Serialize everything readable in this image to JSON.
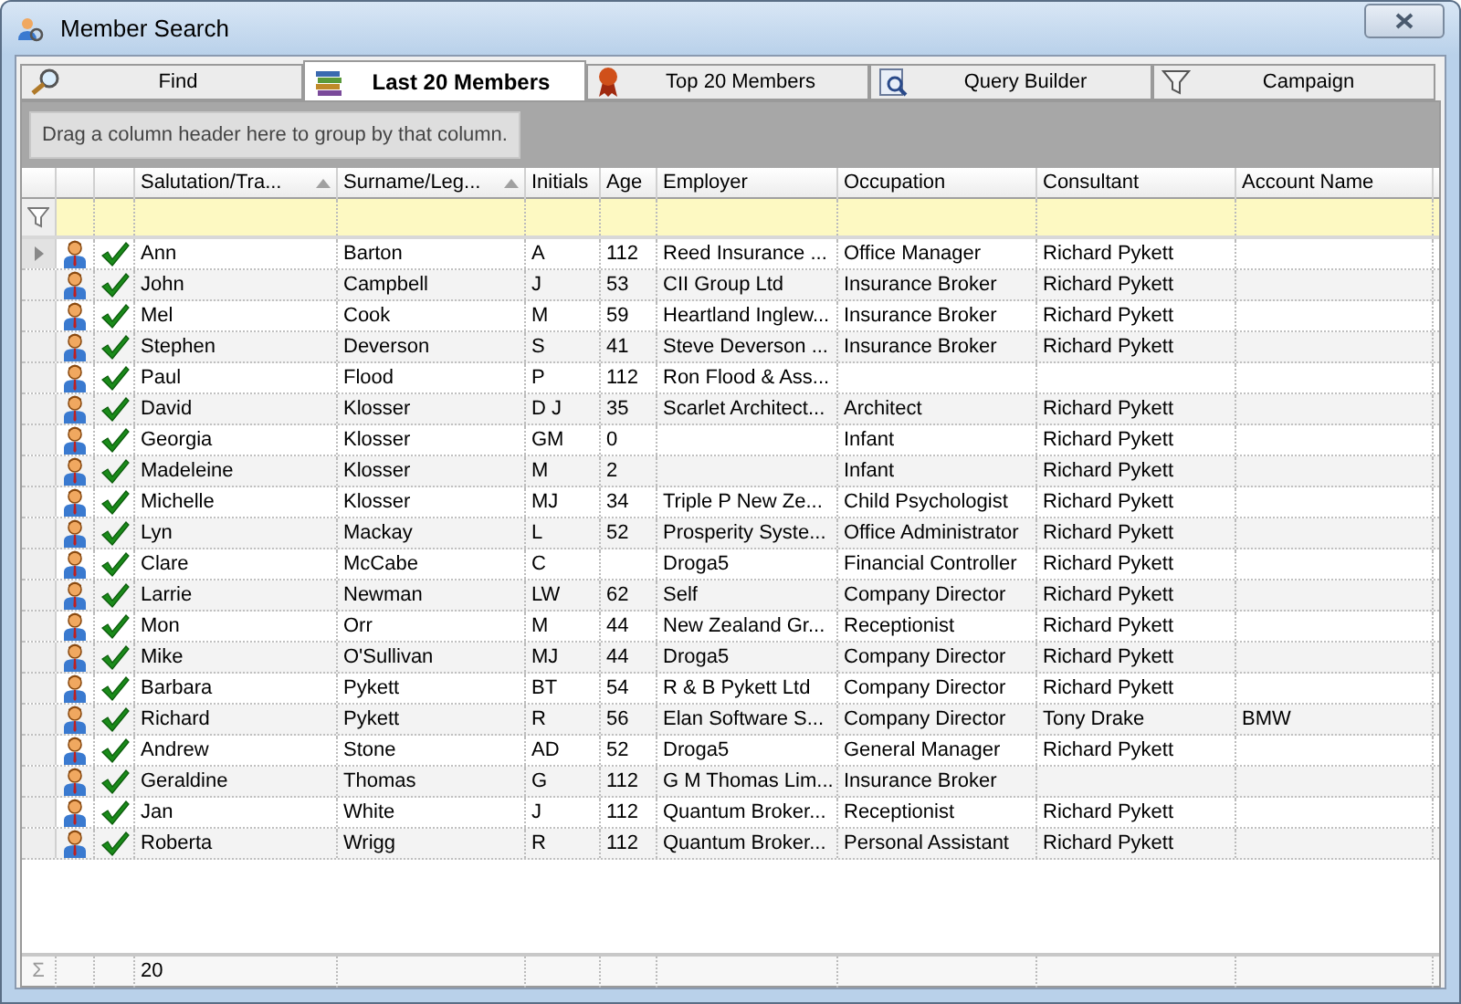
{
  "window": {
    "title": "Member Search"
  },
  "tabs": [
    {
      "label": "Find",
      "kind": "search",
      "selected": false
    },
    {
      "label": "Last 20 Members",
      "kind": "books",
      "selected": true
    },
    {
      "label": "Top 20 Members",
      "kind": "ribbon",
      "selected": false
    },
    {
      "label": "Query Builder",
      "kind": "query",
      "selected": false
    },
    {
      "label": "Campaign",
      "kind": "funnel",
      "selected": false
    }
  ],
  "group_panel": {
    "hint": "Drag a column header here to group by that column."
  },
  "table": {
    "columns": [
      {
        "label": "Salutation/Tra...",
        "sorted": true
      },
      {
        "label": "Surname/Leg...",
        "sorted": true
      },
      {
        "label": "Initials",
        "sorted": false
      },
      {
        "label": "Age",
        "sorted": false
      },
      {
        "label": "Employer",
        "sorted": false
      },
      {
        "label": "Occupation",
        "sorted": false
      },
      {
        "label": "Consultant",
        "sorted": false
      },
      {
        "label": "Account Name",
        "sorted": false
      }
    ],
    "rows": [
      {
        "selected": true,
        "verified": true,
        "cells": [
          "Ann",
          "Barton",
          "A",
          "112",
          "Reed Insurance ...",
          "Office Manager",
          "Richard Pykett",
          ""
        ]
      },
      {
        "selected": false,
        "verified": true,
        "cells": [
          "John",
          "Campbell",
          "J",
          "53",
          "CII Group Ltd",
          "Insurance Broker",
          "Richard Pykett",
          ""
        ]
      },
      {
        "selected": false,
        "verified": true,
        "cells": [
          "Mel",
          "Cook",
          "M",
          "59",
          "Heartland Inglew...",
          "Insurance Broker",
          "Richard Pykett",
          ""
        ]
      },
      {
        "selected": false,
        "verified": true,
        "cells": [
          "Stephen",
          "Deverson",
          "S",
          "41",
          "Steve Deverson ...",
          "Insurance Broker",
          "Richard Pykett",
          ""
        ]
      },
      {
        "selected": false,
        "verified": true,
        "cells": [
          "Paul",
          "Flood",
          "P",
          "112",
          "Ron Flood & Ass...",
          "",
          "",
          ""
        ]
      },
      {
        "selected": false,
        "verified": true,
        "cells": [
          "David",
          "Klosser",
          "D J",
          "35",
          "Scarlet Architect...",
          "Architect",
          "Richard Pykett",
          ""
        ]
      },
      {
        "selected": false,
        "verified": true,
        "cells": [
          "Georgia",
          "Klosser",
          "GM",
          "0",
          "",
          "Infant",
          "Richard Pykett",
          ""
        ]
      },
      {
        "selected": false,
        "verified": true,
        "cells": [
          "Madeleine",
          "Klosser",
          "M",
          "2",
          "",
          "Infant",
          "Richard Pykett",
          ""
        ]
      },
      {
        "selected": false,
        "verified": true,
        "cells": [
          "Michelle",
          "Klosser",
          "MJ",
          "34",
          "Triple P New Ze...",
          "Child Psychologist",
          "Richard Pykett",
          ""
        ]
      },
      {
        "selected": false,
        "verified": true,
        "cells": [
          "Lyn",
          "Mackay",
          "L",
          "52",
          "Prosperity Syste...",
          "Office Administrator",
          "Richard Pykett",
          ""
        ]
      },
      {
        "selected": false,
        "verified": true,
        "cells": [
          "Clare",
          "McCabe",
          "C",
          "",
          "Droga5",
          "Financial Controller",
          "Richard Pykett",
          ""
        ]
      },
      {
        "selected": false,
        "verified": true,
        "cells": [
          "Larrie",
          "Newman",
          "LW",
          "62",
          "Self",
          "Company Director",
          "Richard Pykett",
          ""
        ]
      },
      {
        "selected": false,
        "verified": true,
        "cells": [
          "Mon",
          "Orr",
          "M",
          "44",
          "New Zealand Gr...",
          "Receptionist",
          "Richard Pykett",
          ""
        ]
      },
      {
        "selected": false,
        "verified": true,
        "cells": [
          "Mike",
          "O'Sullivan",
          "MJ",
          "44",
          "Droga5",
          "Company Director",
          "Richard Pykett",
          ""
        ]
      },
      {
        "selected": false,
        "verified": true,
        "cells": [
          "Barbara",
          "Pykett",
          "BT",
          "54",
          "R & B Pykett Ltd",
          "Company Director",
          "Richard Pykett",
          ""
        ]
      },
      {
        "selected": false,
        "verified": true,
        "cells": [
          "Richard",
          "Pykett",
          "R",
          "56",
          "Elan Software S...",
          "Company Director",
          "Tony Drake",
          "BMW"
        ]
      },
      {
        "selected": false,
        "verified": true,
        "cells": [
          "Andrew",
          "Stone",
          "AD",
          "52",
          "Droga5",
          "General Manager",
          "Richard Pykett",
          ""
        ]
      },
      {
        "selected": false,
        "verified": true,
        "cells": [
          "Geraldine",
          "Thomas",
          "G",
          "112",
          "G M Thomas Lim...",
          "Insurance Broker",
          "",
          ""
        ]
      },
      {
        "selected": false,
        "verified": true,
        "cells": [
          "Jan",
          "White",
          "J",
          "112",
          "Quantum Broker...",
          "Receptionist",
          "Richard Pykett",
          ""
        ]
      },
      {
        "selected": false,
        "verified": true,
        "cells": [
          "Roberta",
          "Wrigg",
          "R",
          "112",
          "Quantum Broker...",
          "Personal Assistant",
          "Richard Pykett",
          ""
        ]
      }
    ],
    "footer": {
      "symbol": "Σ",
      "count": "20"
    }
  }
}
